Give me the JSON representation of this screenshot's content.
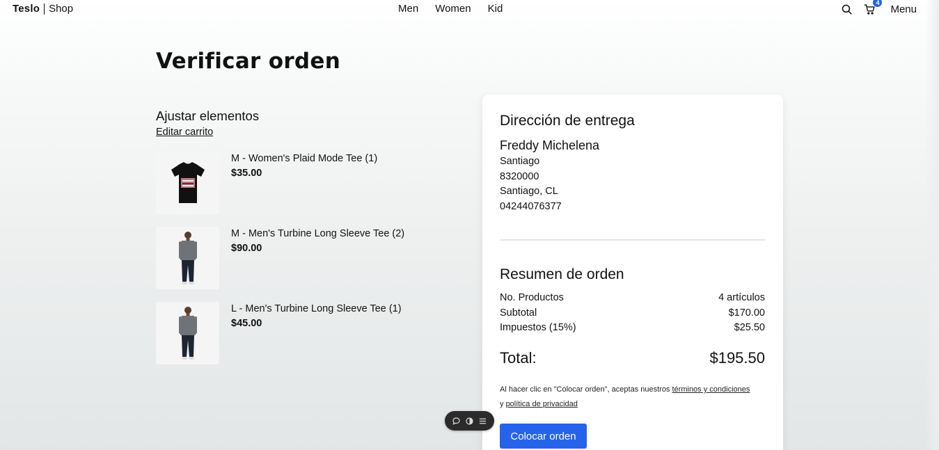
{
  "nav": {
    "logo_strong": "Teslo",
    "logo_light": "Shop",
    "links": [
      "Men",
      "Women",
      "Kid"
    ],
    "cart_count": "4",
    "menu_label": "Menu",
    "icons": [
      "search-icon",
      "cart-icon"
    ]
  },
  "page": {
    "title": "Verificar orden"
  },
  "cart_section": {
    "heading": "Ajustar elementos",
    "edit_link": "Editar carrito",
    "items": [
      {
        "title": "M - Women's Plaid Mode Tee (1)",
        "price": "$35.00",
        "image": "black-tshirt"
      },
      {
        "title": "M - Men's Turbine Long Sleeve Tee (2)",
        "price": "$90.00",
        "image": "man-longsleeve"
      },
      {
        "title": "L - Men's Turbine Long Sleeve Tee (1)",
        "price": "$45.00",
        "image": "man-longsleeve"
      }
    ]
  },
  "address": {
    "heading": "Dirección de entrega",
    "name": "Freddy Michelena",
    "lines": [
      "Santiago",
      "8320000",
      "Santiago, CL",
      "04244076377"
    ]
  },
  "summary": {
    "heading": "Resumen de orden",
    "rows": [
      {
        "label": "No. Productos",
        "value": "4 artículos"
      },
      {
        "label": "Subtotal",
        "value": "$170.00"
      },
      {
        "label": "Impuestos (15%)",
        "value": "$25.50"
      }
    ],
    "total_label": "Total:",
    "total_value": "$195.50",
    "terms_prefix": "Al hacer clic en \"Colocar orden\", aceptas nuestros",
    "terms_link": "términos y condiciones",
    "terms_mid": "y",
    "privacy_link": "política de privacidad",
    "button_label": "Colocar orden"
  },
  "colors": {
    "accent": "#2563eb",
    "toolbar": "#2b2b2b"
  },
  "floating_toolbar": {
    "icons": [
      "comment-icon",
      "toggle-icon",
      "list-icon"
    ]
  }
}
